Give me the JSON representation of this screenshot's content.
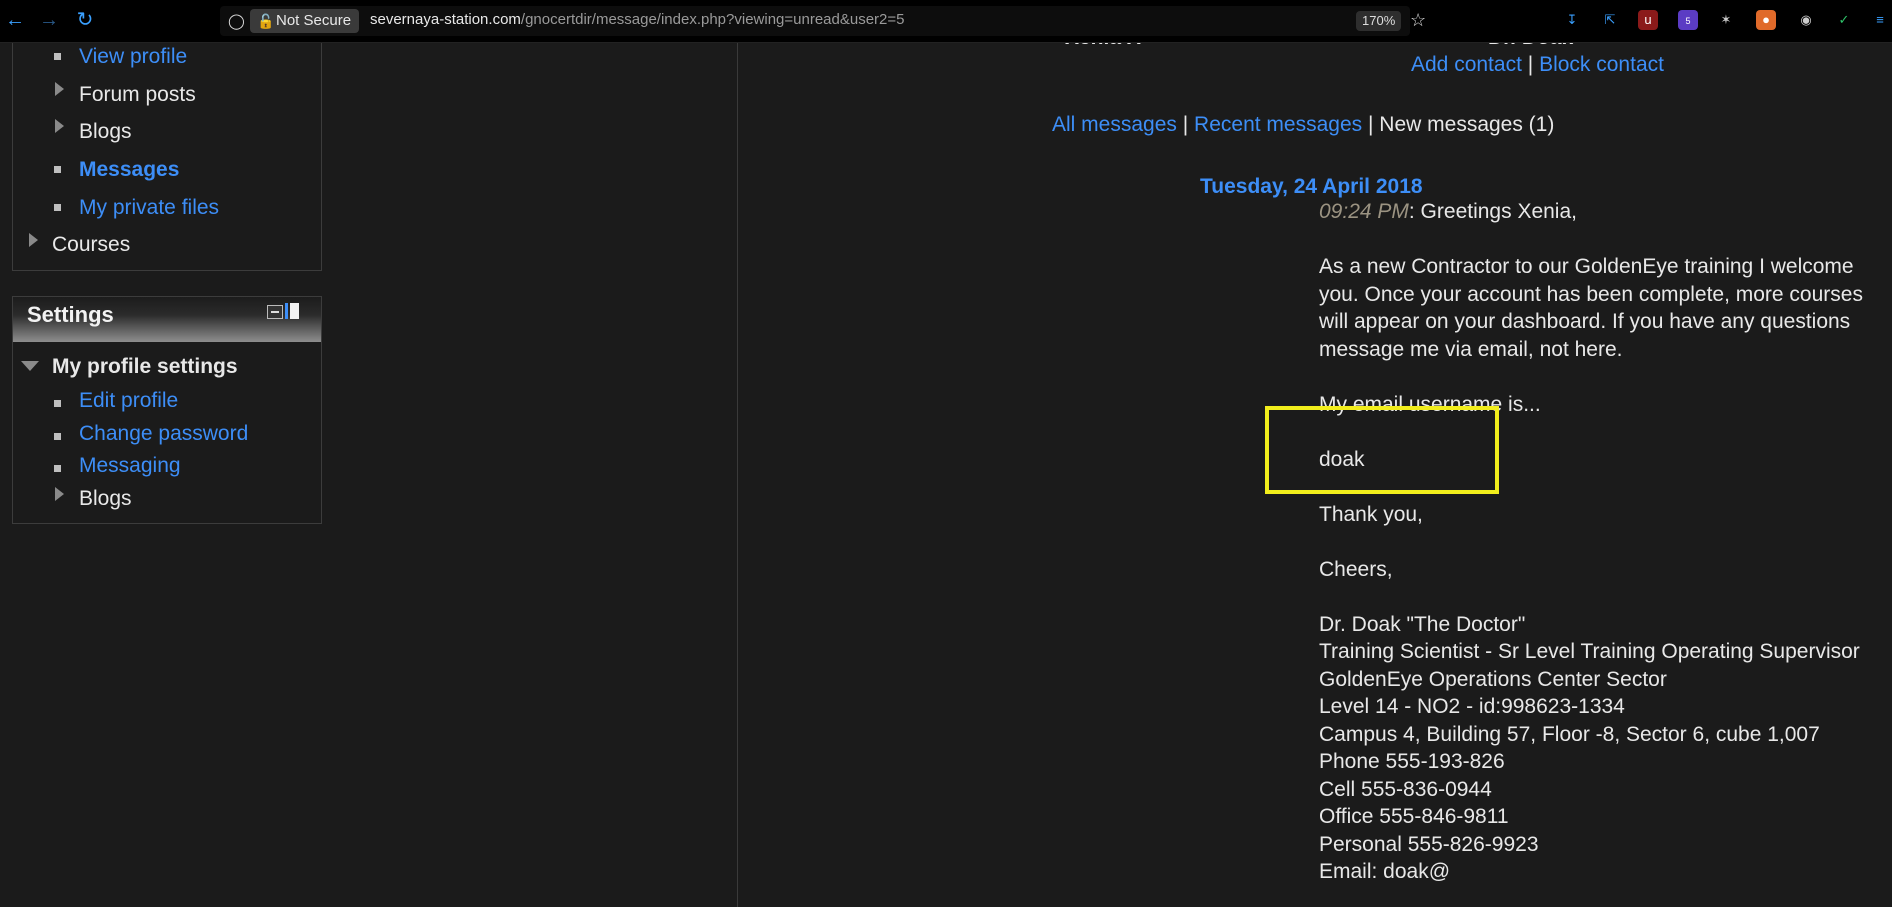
{
  "browser": {
    "security_label": "Not Secure",
    "url_host": "severnaya-station.com",
    "url_path": "/gnocertdir/message/index.php?viewing=unread&user2=5",
    "zoom": "170%",
    "extension_badge": "5"
  },
  "nav": {
    "items": [
      {
        "label": "View profile"
      },
      {
        "label": "Forum posts"
      },
      {
        "label": "Blogs"
      },
      {
        "label": "Messages"
      },
      {
        "label": "My private files"
      },
      {
        "label": "Courses"
      }
    ]
  },
  "settings": {
    "title": "Settings",
    "section": "My profile settings",
    "items": [
      {
        "label": "Edit profile"
      },
      {
        "label": "Change password"
      },
      {
        "label": "Messaging"
      },
      {
        "label": "Blogs"
      }
    ]
  },
  "header": {
    "left_name": "Xenia X",
    "right_name": "Dr. Doak",
    "add_contact": "Add contact",
    "pipe": "|",
    "block_contact": "Block contact"
  },
  "filters": {
    "all": "All messages",
    "recent": "Recent messages",
    "new": "New messages (1)",
    "pipe": "|"
  },
  "message": {
    "date": "Tuesday, 24 April 2018",
    "time": "09:24 PM",
    "greeting": ": Greetings Xenia,",
    "para1": "As a new Contractor to our GoldenEye training I welcome you. Once your account has been complete, more courses will appear on your dashboard. If you have any questions message me via email, not here.",
    "para2": "My email username is...",
    "username": "doak",
    "thanks": "Thank you,",
    "cheers": "Cheers,",
    "signature": [
      "Dr. Doak \"The Doctor\"",
      "Training Scientist - Sr Level Training Operating Supervisor",
      "GoldenEye Operations Center Sector",
      "Level 14 - NO2 - id:998623-1334",
      "Campus 4, Building 57, Floor -8, Sector 6, cube 1,007",
      "Phone 555-193-826",
      "Cell 555-836-0944",
      "Office 555-846-9811",
      "Personal 555-826-9923",
      "Email: doak@"
    ]
  },
  "colors": {
    "link": "#3d8ef7",
    "highlight": "#f2ee1c",
    "background": "#1b1b1b"
  }
}
